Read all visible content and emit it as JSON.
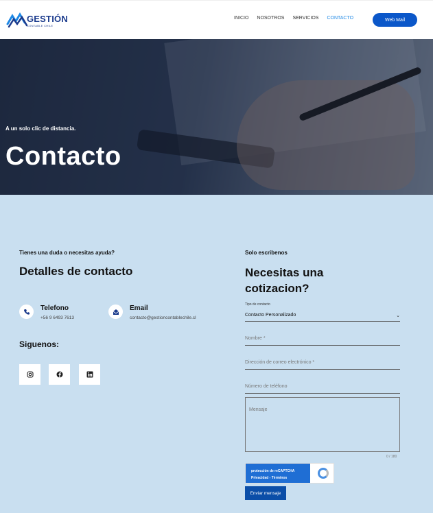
{
  "header": {
    "logo_text": "GESTIÓN",
    "logo_sub": "CONTABLE CHILE",
    "nav": [
      "INICIO",
      "NOSOTROS",
      "SERVICIOS",
      "CONTACTO"
    ],
    "active_nav": "CONTACTO",
    "webmail_label": "Web Mail"
  },
  "hero": {
    "tagline": "A un solo clic de distancia.",
    "title": "Contacto"
  },
  "left": {
    "eyebrow": "Tienes una duda o necesitas ayuda?",
    "title": "Detalles de contacto",
    "phone_label": "Telefono",
    "phone_value": "+56 9 6493 7613",
    "email_label": "Email",
    "email_value": "contacto@gestioncontablechile.cl",
    "follow_title": "Siguenos:",
    "social_icons": [
      "instagram-icon",
      "facebook-icon",
      "linkedin-icon"
    ]
  },
  "form": {
    "eyebrow": "Solo escribenos",
    "title": "Necesitas una cotizacion?",
    "contact_type_label": "Tipo de contacto",
    "contact_type_value": "Contacto Personalizado",
    "name_placeholder": "Nombre *",
    "email_placeholder": "Dirección de correo electrónico *",
    "phone_placeholder": "Número de teléfono",
    "message_placeholder": "Mensaje",
    "char_count": "0 / 180",
    "recaptcha_line1": "protección de reCAPTCHA",
    "recaptcha_line2": "Privacidad - Términos",
    "submit_label": "Enviar mensaje"
  },
  "colors": {
    "brand_blue": "#0b57c9",
    "background": "#c9dff0",
    "active_nav": "#1e88e5"
  }
}
